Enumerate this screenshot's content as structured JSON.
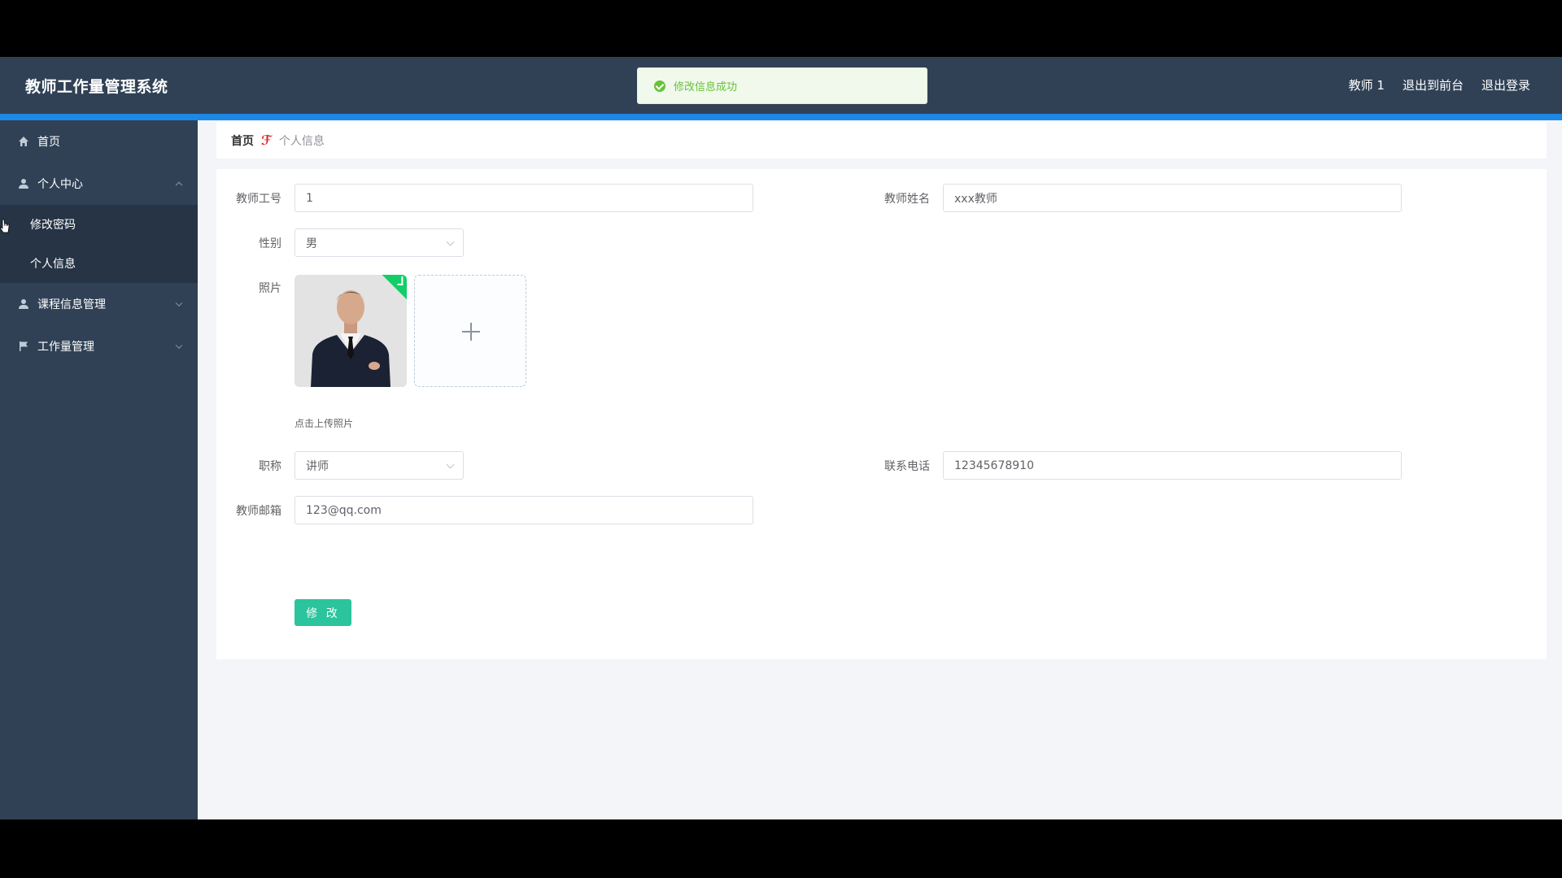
{
  "app": {
    "title": "教师工作量管理系统"
  },
  "header": {
    "user": "教师 1",
    "back_frontend": "退出到前台",
    "logout": "退出登录"
  },
  "toast": {
    "message": "修改信息成功",
    "icon": "success-check-icon",
    "color": "#67c23a"
  },
  "sidebar": {
    "items": [
      {
        "label": "首页",
        "icon": "home-icon"
      },
      {
        "label": "个人中心",
        "icon": "user-icon",
        "expanded": true,
        "children": [
          {
            "label": "修改密码"
          },
          {
            "label": "个人信息"
          }
        ]
      },
      {
        "label": "课程信息管理",
        "icon": "user-icon"
      },
      {
        "label": "工作量管理",
        "icon": "flag-icon"
      }
    ]
  },
  "breadcrumb": {
    "home": "首页",
    "current": "个人信息"
  },
  "form": {
    "teacher_no": {
      "label": "教师工号",
      "value": "1"
    },
    "teacher_name": {
      "label": "教师姓名",
      "value": "xxx教师"
    },
    "gender": {
      "label": "性别",
      "value": "男"
    },
    "photo": {
      "label": "照片",
      "tip": "点击上传照片"
    },
    "title": {
      "label": "职称",
      "value": "讲师"
    },
    "phone": {
      "label": "联系电话",
      "value": "12345678910"
    },
    "email": {
      "label": "教师邮箱",
      "value": "123@qq.com"
    },
    "submit_label": "修 改"
  },
  "colors": {
    "header_bg": "#304156",
    "accent_bar": "#1e88e5",
    "button": "#2bc49c"
  }
}
